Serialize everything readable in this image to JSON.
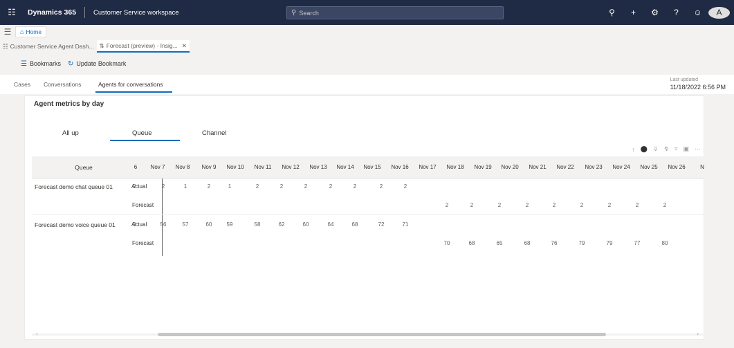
{
  "topbar": {
    "app_name": "Dynamics 365",
    "workspace": "Customer Service workspace",
    "search_placeholder": "Search",
    "avatar_initial": "A"
  },
  "nav": {
    "home_tab": "Home"
  },
  "session_tabs": [
    {
      "label": "Customer Service Agent Dash..."
    },
    {
      "label": "Forecast (preview) - Insig..."
    }
  ],
  "commands": {
    "bookmarks": "Bookmarks",
    "update_bookmark": "Update Bookmark"
  },
  "page_tabs": [
    "Cases",
    "Conversations",
    "Agents for conversations"
  ],
  "last_updated": {
    "label": "Last updated",
    "value": "11/18/2022 6:56 PM"
  },
  "panel": {
    "title": "Agent metrics by day",
    "views": [
      "All up",
      "Queue",
      "Channel"
    ]
  },
  "grid": {
    "queue_header": "Queue",
    "dates": [
      "6",
      "Nov 7",
      "Nov 8",
      "Nov 9",
      "Nov 10",
      "Nov 11",
      "Nov 12",
      "Nov 13",
      "Nov 14",
      "Nov 15",
      "Nov 16",
      "Nov 17",
      "Nov 18",
      "Nov 19",
      "Nov 20",
      "Nov 21",
      "Nov 22",
      "Nov 23",
      "Nov 24",
      "Nov 25",
      "Nov 26",
      "N"
    ],
    "rows": [
      {
        "queue": "Forecast demo chat queue 01",
        "actual_label": "Actual",
        "forecast_label": "Forecast",
        "actual": [
          "2",
          "2",
          "1",
          "2",
          "1",
          "2",
          "2",
          "2",
          "2",
          "2",
          "2",
          "2"
        ],
        "forecast": [
          "2",
          "2",
          "2",
          "2",
          "2",
          "2",
          "2",
          "2",
          "2"
        ]
      },
      {
        "queue": "Forecast demo voice queue 01",
        "actual_label": "Actual",
        "forecast_label": "Forecast",
        "actual": [
          "3",
          "56",
          "57",
          "60",
          "59",
          "58",
          "62",
          "60",
          "64",
          "68",
          "72",
          "71"
        ],
        "forecast": [
          "70",
          "68",
          "65",
          "68",
          "76",
          "79",
          "79",
          "77",
          "80"
        ]
      }
    ]
  }
}
